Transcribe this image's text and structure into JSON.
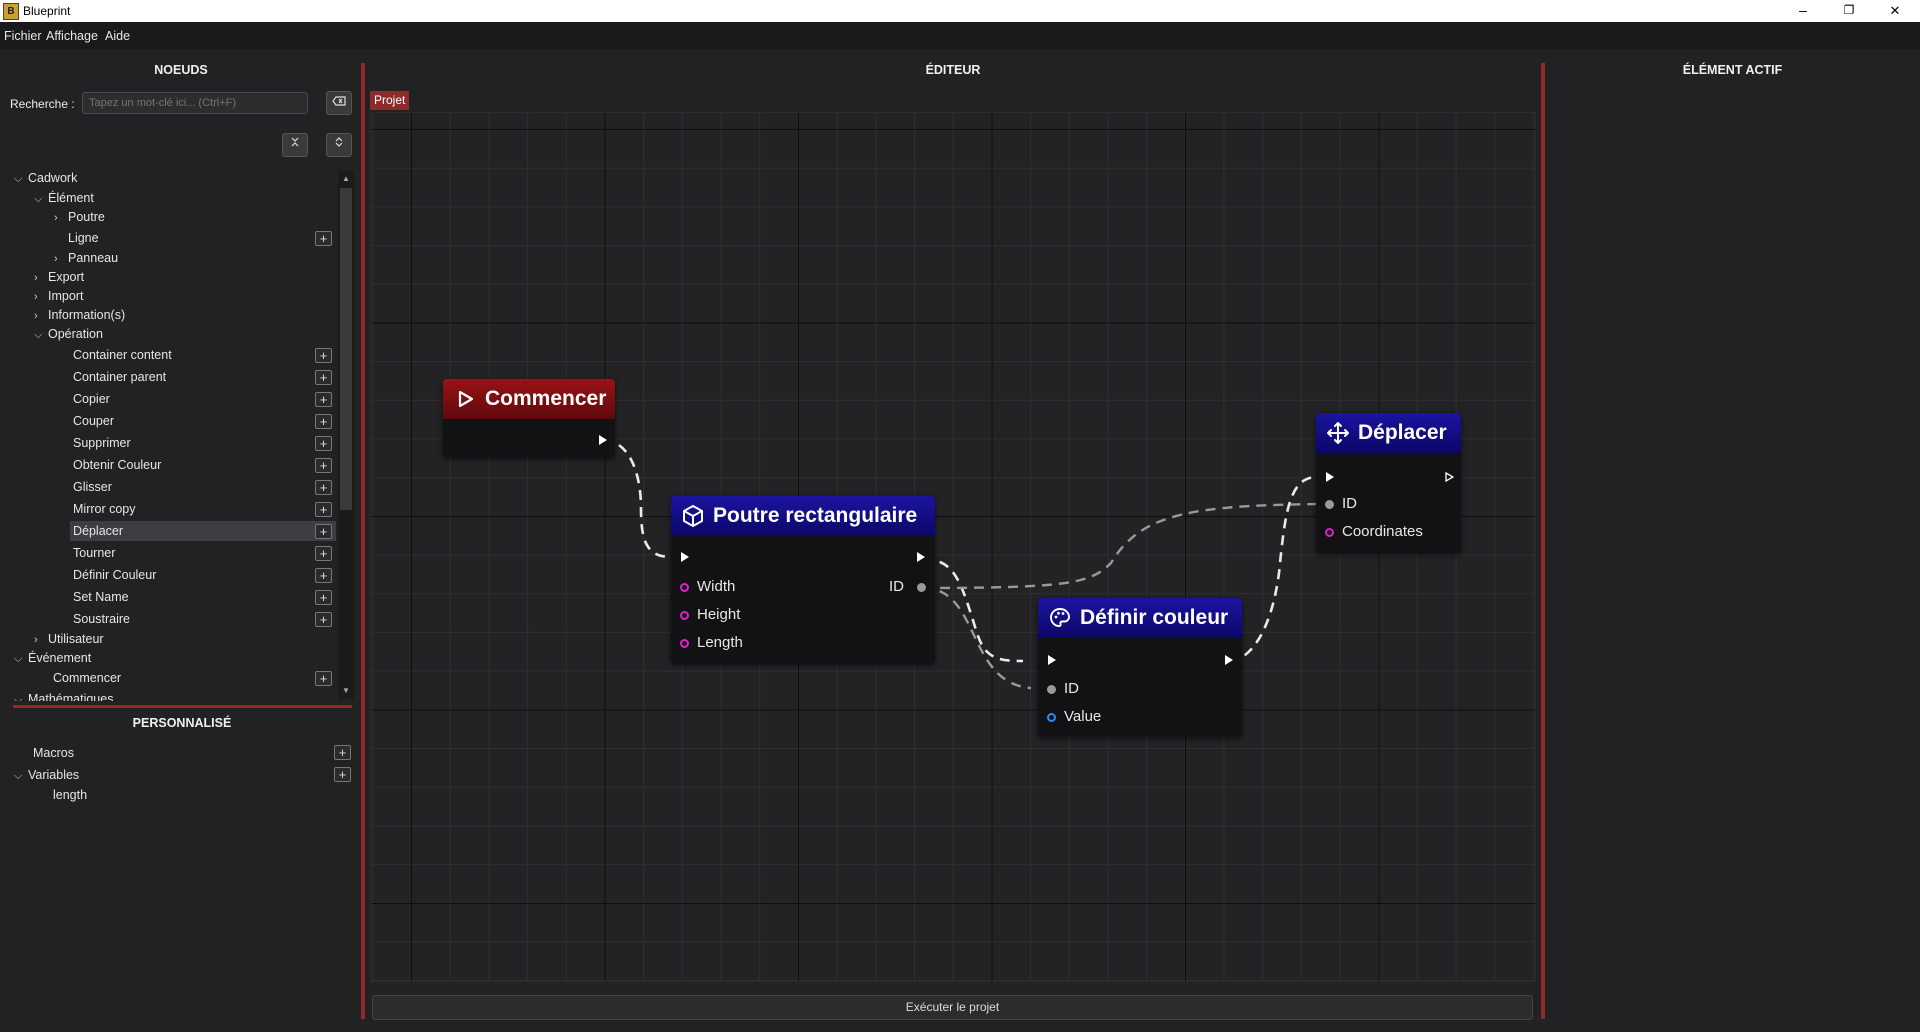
{
  "window": {
    "title": "Blueprint",
    "minimize": "–",
    "maximize": "❐",
    "close": "✕"
  },
  "menu": [
    "Fichier",
    "Affichage",
    "Aide"
  ],
  "left_panel": {
    "header": "NOEUDS",
    "search_label": "Recherche :",
    "search_placeholder": "Tapez un mot-clé ici... (Ctrl+F)",
    "tree": [
      {
        "label": "Cadwork",
        "chev": "⌵"
      },
      {
        "label": "Élément",
        "chev": "⌵"
      },
      {
        "label": "Poutre",
        "chev": "›"
      },
      {
        "label": "Ligne",
        "chev": ""
      },
      {
        "label": "Panneau",
        "chev": "›"
      },
      {
        "label": "Export",
        "chev": "›"
      },
      {
        "label": "Import",
        "chev": "›"
      },
      {
        "label": "Information(s)",
        "chev": "›"
      },
      {
        "label": "Opération",
        "chev": "⌵"
      },
      {
        "label": "Container content"
      },
      {
        "label": "Container parent"
      },
      {
        "label": "Copier"
      },
      {
        "label": "Couper"
      },
      {
        "label": "Supprimer"
      },
      {
        "label": "Obtenir Couleur"
      },
      {
        "label": "Glisser"
      },
      {
        "label": "Mirror copy"
      },
      {
        "label": "Déplacer"
      },
      {
        "label": "Tourner"
      },
      {
        "label": "Définir Couleur"
      },
      {
        "label": "Set Name"
      },
      {
        "label": "Soustraire"
      },
      {
        "label": "Utilisateur",
        "chev": "›"
      },
      {
        "label": "Événement",
        "chev": "⌵"
      },
      {
        "label": "Commencer"
      },
      {
        "label": "Mathématiques",
        "chev": "⌵"
      }
    ],
    "custom_header": "PERSONNALISÉ",
    "custom": [
      {
        "label": "Macros",
        "chev": ""
      },
      {
        "label": "Variables",
        "chev": "⌵"
      },
      {
        "label": "length",
        "chev": ""
      }
    ]
  },
  "editor": {
    "header": "ÉDITEUR",
    "tab": "Projet",
    "run_button": "Exécuter le projet",
    "nodes": {
      "start": {
        "title": "Commencer"
      },
      "beam": {
        "title": "Poutre rectangulaire",
        "inputs": [
          "Width",
          "Height",
          "Length"
        ],
        "output": "ID"
      },
      "color": {
        "title": "Définir couleur",
        "inputs": [
          "ID",
          "Value"
        ]
      },
      "move": {
        "title": "Déplacer",
        "inputs": [
          "ID",
          "Coordinates"
        ]
      }
    }
  },
  "right_panel": {
    "header": "ÉLÉMENT ACTIF"
  },
  "colors": {
    "accent_red": "#8e2a2c",
    "node_red": "#9a1216",
    "node_blue": "#1b14a0",
    "pin_magenta": "#e020c8",
    "pin_blue": "#2a8cff"
  }
}
